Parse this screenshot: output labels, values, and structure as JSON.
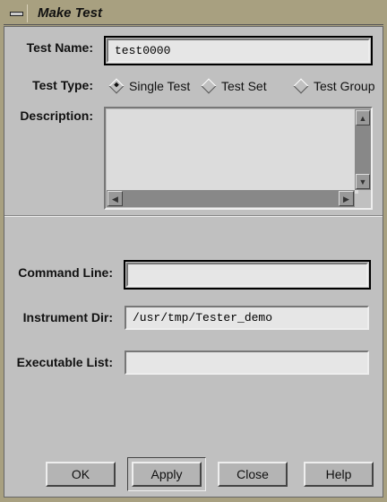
{
  "window": {
    "title": "Make Test"
  },
  "form": {
    "test_name": {
      "label": "Test Name:",
      "value": "test0000"
    },
    "test_type": {
      "label": "Test Type:",
      "options": [
        {
          "label": "Single Test",
          "selected": true
        },
        {
          "label": "Test Set",
          "selected": false
        },
        {
          "label": "Test Group",
          "selected": false
        }
      ]
    },
    "description": {
      "label": "Description:",
      "value": ""
    },
    "command_line": {
      "label": "Command Line:",
      "value": ""
    },
    "instrument_dir": {
      "label": "Instrument Dir:",
      "value": "/usr/tmp/Tester_demo"
    },
    "executable_list": {
      "label": "Executable List:",
      "value": ""
    }
  },
  "buttons": {
    "ok": "OK",
    "apply": "Apply",
    "close": "Close",
    "help": "Help"
  }
}
